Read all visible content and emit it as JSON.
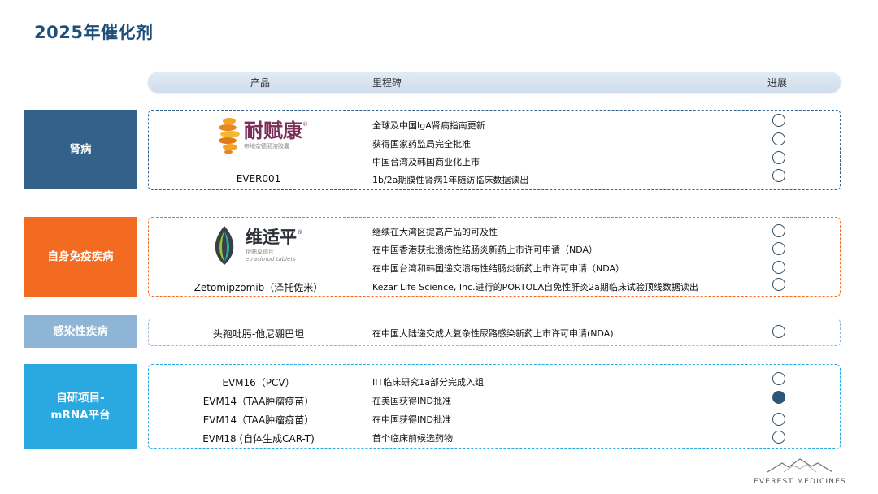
{
  "title": "2025年催化剂",
  "header": {
    "product": "产品",
    "milestone": "里程碑",
    "progress": "进展"
  },
  "colors": {
    "title": "#1f4e79",
    "rule": "#f2a06b",
    "renal": "#336189",
    "autoimmune": "#f26b21",
    "infection": "#8fb5d6",
    "inhouse": "#2aa8e0",
    "progress_filled": "#2d5576"
  },
  "groups": [
    {
      "category": "肾病",
      "logo": {
        "name": "耐赋康",
        "registered": "®",
        "sub": "布地奈德肠溶胶囊",
        "icon": "spiral-logo-icon"
      },
      "products": [
        "EVER001"
      ],
      "milestones": [
        "全球及中国IgA肾病指南更新",
        "获得国家药监局完全批准",
        "中国台湾及韩国商业化上市",
        "1b/2a期膜性肾病1年随访临床数据读出"
      ],
      "progress": [
        false,
        false,
        false,
        false
      ]
    },
    {
      "category": "自身免疫疾病",
      "logo": {
        "name": "维适平",
        "registered": "®",
        "sub": "伊曲莫德片",
        "sub2": "etrasimod tablets",
        "icon": "leaf-logo-icon"
      },
      "products": [
        "Zetomipzomib（泽托佐米）"
      ],
      "milestones": [
        "继续在大湾区提高产品的可及性",
        "在中国香港获批溃疡性结肠炎新药上市许可申请（NDA）",
        "在中国台湾和韩国递交溃疡性结肠炎新药上市许可申请（NDA）",
        "Kezar Life Science, Inc.进行的PORTOLA自免性肝炎2a期临床试验顶线数据读出"
      ],
      "progress": [
        false,
        false,
        false,
        false
      ]
    },
    {
      "category": "感染性疾病",
      "products": [
        "头孢吡肟-他尼硼巴坦"
      ],
      "milestones": [
        "在中国大陆递交成人复杂性尿路感染新药上市许可申请(NDA)"
      ],
      "progress": [
        false
      ]
    },
    {
      "category_line1": "自研项目-",
      "category_line2": "mRNA平台",
      "products": [
        "EVM16（PCV）",
        "EVM14（TAA肿瘤疫苗）",
        "EVM14（TAA肿瘤疫苗）",
        "EVM18 (自体生成CAR-T)"
      ],
      "milestones": [
        "IIT临床研究1a部分完成入组",
        "在美国获得IND批准",
        "在中国获得IND批准",
        "首个临床前候选药物"
      ],
      "progress": [
        false,
        true,
        false,
        false
      ]
    }
  ],
  "footer": {
    "company": "EVEREST MEDICINES",
    "icon": "mountain-logo-icon"
  }
}
